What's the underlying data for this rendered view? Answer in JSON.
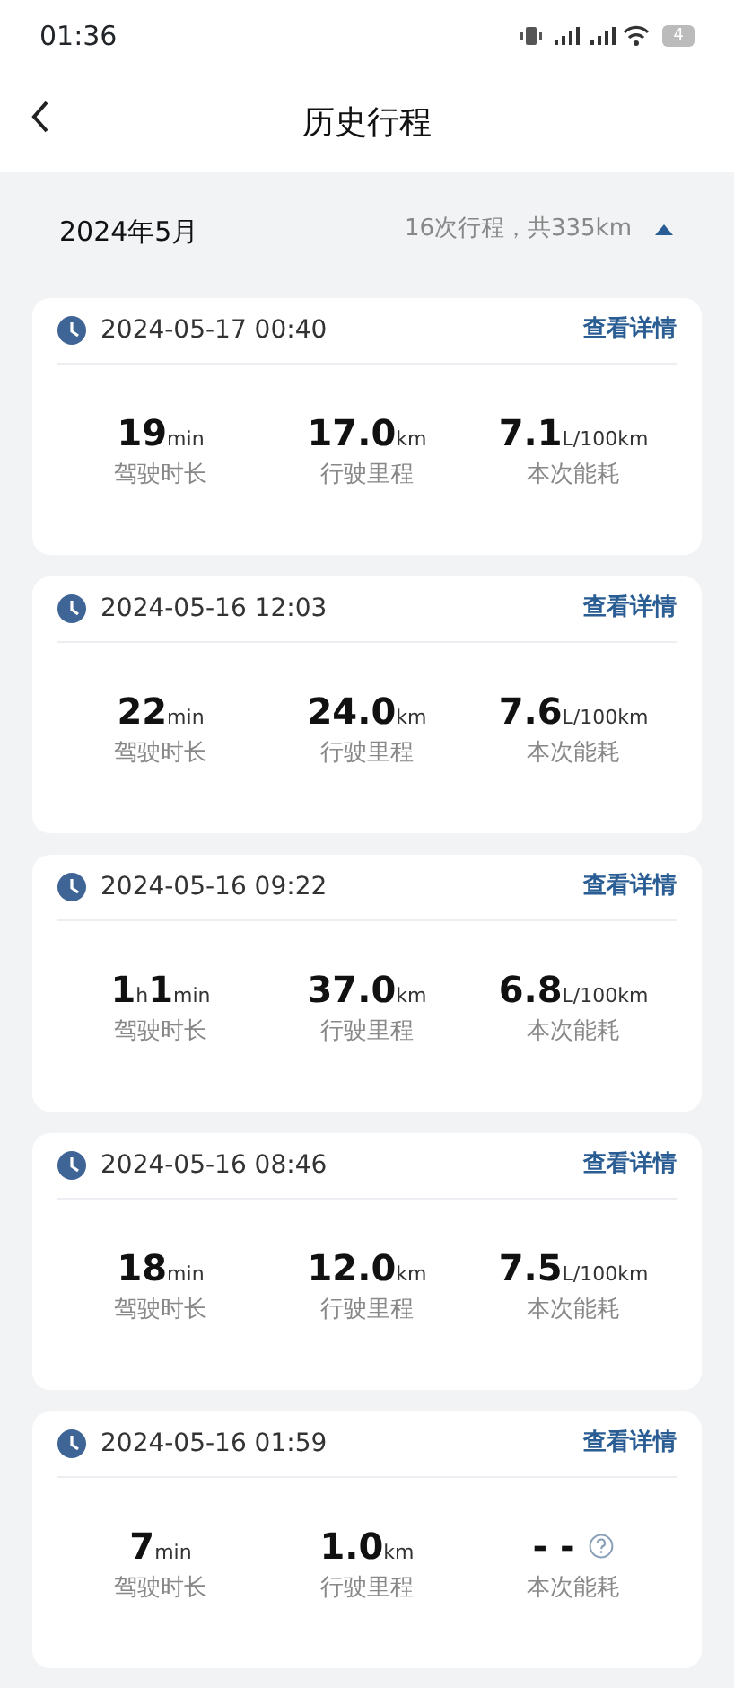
{
  "status_bar": {
    "time": "01:36",
    "battery": "4"
  },
  "header": {
    "title": "历史行程"
  },
  "summary": {
    "month": "2024年5月",
    "totals": "16次行程，共335km",
    "expanded": true
  },
  "trips": [
    {
      "datetime": "2024-05-17 00:40",
      "link": "查看详情",
      "stats": [
        {
          "parts": [
            {
              "kind": "num",
              "text": "19"
            },
            {
              "kind": "unit",
              "text": "min"
            }
          ],
          "label": "驾驶时长"
        },
        {
          "parts": [
            {
              "kind": "num",
              "text": "17.0"
            },
            {
              "kind": "unit",
              "text": "km"
            }
          ],
          "label": "行驶里程"
        },
        {
          "parts": [
            {
              "kind": "num",
              "text": "7.1"
            },
            {
              "kind": "unit",
              "text": "L/100km"
            }
          ],
          "label": "本次能耗"
        }
      ]
    },
    {
      "datetime": "2024-05-16 12:03",
      "link": "查看详情",
      "stats": [
        {
          "parts": [
            {
              "kind": "num",
              "text": "22"
            },
            {
              "kind": "unit",
              "text": "min"
            }
          ],
          "label": "驾驶时长"
        },
        {
          "parts": [
            {
              "kind": "num",
              "text": "24.0"
            },
            {
              "kind": "unit",
              "text": "km"
            }
          ],
          "label": "行驶里程"
        },
        {
          "parts": [
            {
              "kind": "num",
              "text": "7.6"
            },
            {
              "kind": "unit",
              "text": "L/100km"
            }
          ],
          "label": "本次能耗"
        }
      ]
    },
    {
      "datetime": "2024-05-16 09:22",
      "link": "查看详情",
      "stats": [
        {
          "parts": [
            {
              "kind": "num",
              "text": "1"
            },
            {
              "kind": "unit",
              "text": "h"
            },
            {
              "kind": "num",
              "text": "1"
            },
            {
              "kind": "unit",
              "text": "min"
            }
          ],
          "label": "驾驶时长"
        },
        {
          "parts": [
            {
              "kind": "num",
              "text": "37.0"
            },
            {
              "kind": "unit",
              "text": "km"
            }
          ],
          "label": "行驶里程"
        },
        {
          "parts": [
            {
              "kind": "num",
              "text": "6.8"
            },
            {
              "kind": "unit",
              "text": "L/100km"
            }
          ],
          "label": "本次能耗"
        }
      ]
    },
    {
      "datetime": "2024-05-16 08:46",
      "link": "查看详情",
      "stats": [
        {
          "parts": [
            {
              "kind": "num",
              "text": "18"
            },
            {
              "kind": "unit",
              "text": "min"
            }
          ],
          "label": "驾驶时长"
        },
        {
          "parts": [
            {
              "kind": "num",
              "text": "12.0"
            },
            {
              "kind": "unit",
              "text": "km"
            }
          ],
          "label": "行驶里程"
        },
        {
          "parts": [
            {
              "kind": "num",
              "text": "7.5"
            },
            {
              "kind": "unit",
              "text": "L/100km"
            }
          ],
          "label": "本次能耗"
        }
      ]
    },
    {
      "datetime": "2024-05-16 01:59",
      "link": "查看详情",
      "stats": [
        {
          "parts": [
            {
              "kind": "num",
              "text": "7"
            },
            {
              "kind": "unit",
              "text": "min"
            }
          ],
          "label": "驾驶时长"
        },
        {
          "parts": [
            {
              "kind": "num",
              "text": "1.0"
            },
            {
              "kind": "unit",
              "text": "km"
            }
          ],
          "label": "行驶里程"
        },
        {
          "parts": [
            {
              "kind": "num",
              "text": "- -"
            }
          ],
          "label": "本次能耗",
          "help_icon": true
        }
      ]
    }
  ]
}
